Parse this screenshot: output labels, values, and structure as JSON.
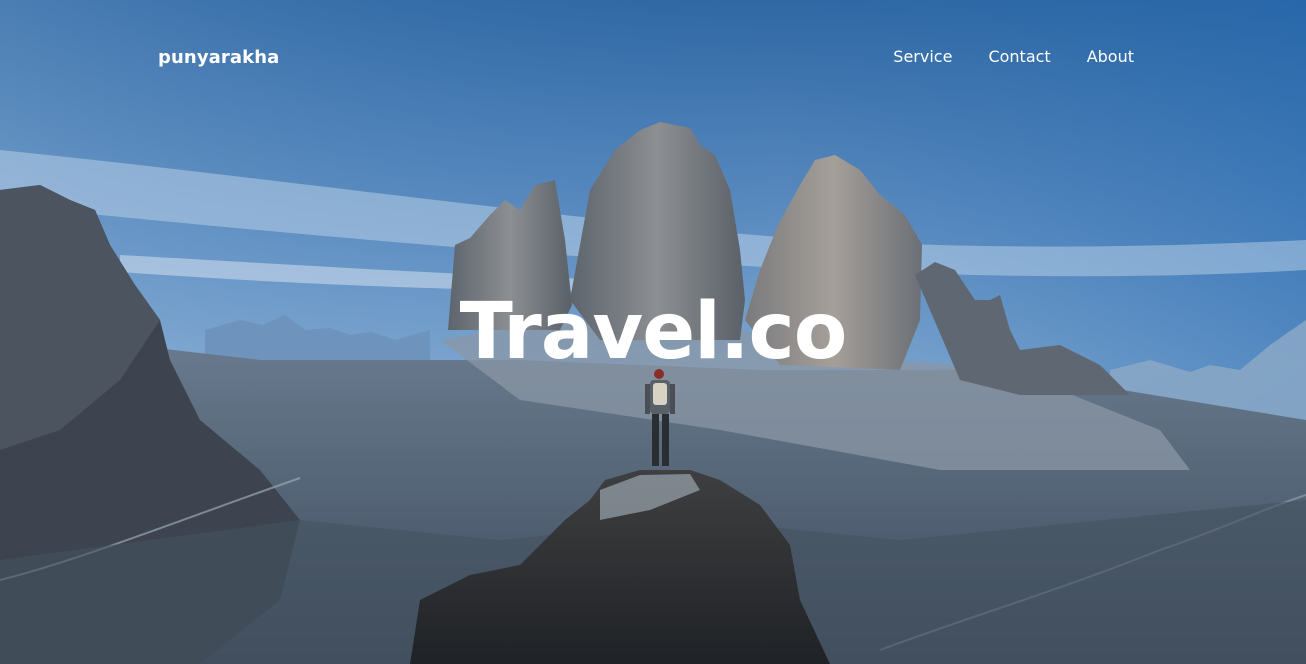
{
  "brand": {
    "name": "punyarakha"
  },
  "nav": {
    "items": [
      {
        "label": "Service"
      },
      {
        "label": "Contact"
      },
      {
        "label": "About"
      }
    ]
  },
  "hero": {
    "title": "Travel.co",
    "background": "mountain-landscape-photo"
  },
  "colors": {
    "sky_top": "#3a6fa3",
    "sky_mid": "#5b8bbd",
    "rock": "#6a6e72",
    "text": "#ffffff"
  }
}
